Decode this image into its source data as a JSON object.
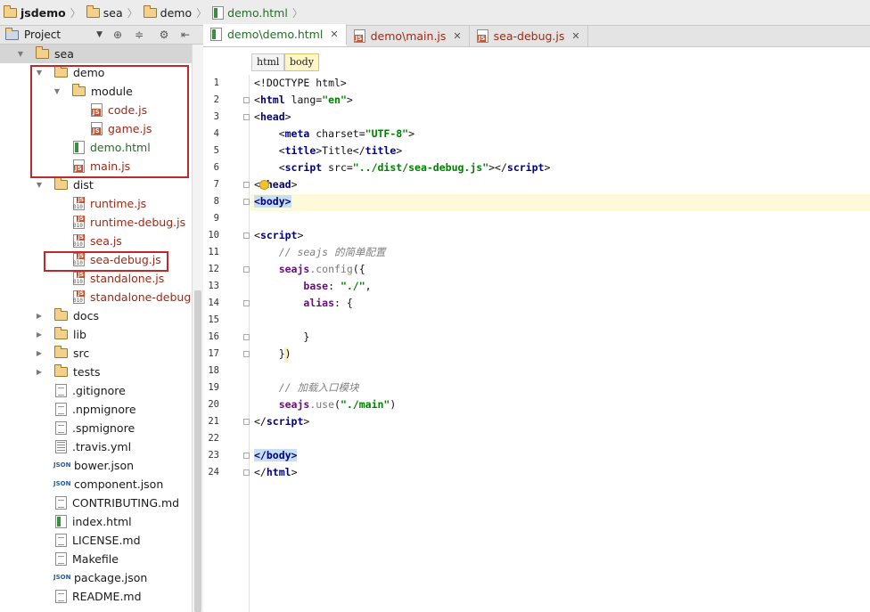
{
  "breadcrumb": [
    "jsdemo",
    "sea",
    "demo",
    "demo.html"
  ],
  "project_panel": {
    "title": "Project"
  },
  "tree": [
    {
      "name": "sea",
      "kind": "folder",
      "expanded": true
    },
    {
      "name": "demo",
      "kind": "folder",
      "expanded": true
    },
    {
      "name": "module",
      "kind": "folder",
      "expanded": true
    },
    {
      "name": "code.js",
      "kind": "js"
    },
    {
      "name": "game.js",
      "kind": "js"
    },
    {
      "name": "demo.html",
      "kind": "html"
    },
    {
      "name": "main.js",
      "kind": "js"
    },
    {
      "name": "dist",
      "kind": "folder",
      "expanded": true
    },
    {
      "name": "runtime.js",
      "kind": "bin"
    },
    {
      "name": "runtime-debug.js",
      "kind": "bin"
    },
    {
      "name": "sea.js",
      "kind": "bin"
    },
    {
      "name": "sea-debug.js",
      "kind": "bin"
    },
    {
      "name": "standalone.js",
      "kind": "bin"
    },
    {
      "name": "standalone-debug.js",
      "kind": "bin"
    },
    {
      "name": "docs",
      "kind": "folder",
      "expanded": false
    },
    {
      "name": "lib",
      "kind": "folder",
      "expanded": false
    },
    {
      "name": "src",
      "kind": "folder",
      "expanded": false
    },
    {
      "name": "tests",
      "kind": "folder",
      "expanded": false
    },
    {
      "name": ".gitignore",
      "kind": "txt"
    },
    {
      "name": ".npmignore",
      "kind": "txt"
    },
    {
      "name": ".spmignore",
      "kind": "txt"
    },
    {
      "name": ".travis.yml",
      "kind": "yml"
    },
    {
      "name": "bower.json",
      "kind": "json"
    },
    {
      "name": "component.json",
      "kind": "json"
    },
    {
      "name": "CONTRIBUTING.md",
      "kind": "txt"
    },
    {
      "name": "index.html",
      "kind": "html"
    },
    {
      "name": "LICENSE.md",
      "kind": "txt"
    },
    {
      "name": "Makefile",
      "kind": "txt"
    },
    {
      "name": "package.json",
      "kind": "json"
    },
    {
      "name": "README.md",
      "kind": "txt"
    }
  ],
  "tabs": [
    {
      "label": "demo\\demo.html",
      "kind": "html",
      "active": true
    },
    {
      "label": "demo\\main.js",
      "kind": "js",
      "active": false
    },
    {
      "label": "sea-debug.js",
      "kind": "js",
      "active": false
    }
  ],
  "tag_path": [
    "html",
    "body"
  ],
  "line_numbers": [
    "1",
    "2",
    "3",
    "4",
    "5",
    "6",
    "7",
    "8",
    "9",
    "10",
    "11",
    "12",
    "13",
    "14",
    "15",
    "16",
    "17",
    "18",
    "19",
    "20",
    "21",
    "22",
    "23",
    "24"
  ],
  "code": {
    "l1": "<!DOCTYPE html>",
    "l2_a": "<",
    "l2_tag": "html",
    "l2_attr": " lang=",
    "l2_val": "\"en\"",
    "l2_b": ">",
    "l3_a": "<",
    "l3_tag": "head",
    "l3_b": ">",
    "l4_a": "    <",
    "l4_tag": "meta",
    "l4_attr": " charset=",
    "l4_val": "\"UTF-8\"",
    "l4_b": ">",
    "l5_a": "    <",
    "l5_tag": "title",
    "l5_text": ">Title</",
    "l5_tag2": "title",
    "l5_b": ">",
    "l6_a": "    <",
    "l6_tag": "script",
    "l6_attr": " src=",
    "l6_val": "\"../dist/sea-debug.js\"",
    "l6_text": "></",
    "l6_tag2": "script",
    "l6_b": ">",
    "l7_a": "</",
    "l7_tag": "head",
    "l7_b": ">",
    "l8": "<body>",
    "l10_a": "<",
    "l10_tag": "script",
    "l10_b": ">",
    "l11": "    // seajs 的简单配置",
    "l12_a": "    ",
    "l12_obj": "seajs",
    "l12_fn": ".config",
    "l12_b": "({",
    "l13_a": "        ",
    "l13_prop": "base",
    "l13_b": ": ",
    "l13_val": "\"./\"",
    "l13_c": ",",
    "l14_a": "        ",
    "l14_prop": "alias",
    "l14_b": ": {",
    "l16": "        }",
    "l17": "    })",
    "l19": "    // 加载入口模块",
    "l20_a": "    ",
    "l20_obj": "seajs",
    "l20_fn": ".use",
    "l20_b": "(",
    "l20_val": "\"./main\"",
    "l20_c": ")",
    "l21_a": "</",
    "l21_tag": "script",
    "l21_b": ">",
    "l23": "</body>",
    "l24_a": "</",
    "l24_tag": "html",
    "l24_b": ">"
  }
}
